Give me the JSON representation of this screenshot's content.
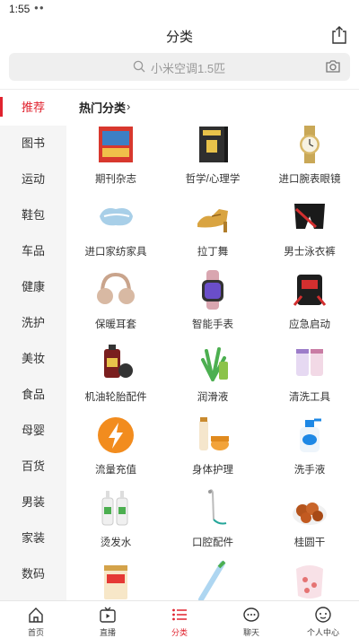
{
  "status": {
    "time": "1:55",
    "dots": "●●"
  },
  "header": {
    "title": "分类"
  },
  "search": {
    "placeholder": "小米空调1.5匹"
  },
  "sidebar": {
    "items": [
      {
        "label": "推荐",
        "active": true
      },
      {
        "label": "图书"
      },
      {
        "label": "运动"
      },
      {
        "label": "鞋包"
      },
      {
        "label": "车品"
      },
      {
        "label": "健康"
      },
      {
        "label": "洗护"
      },
      {
        "label": "美妆"
      },
      {
        "label": "食品"
      },
      {
        "label": "母婴"
      },
      {
        "label": "百货"
      },
      {
        "label": "男装"
      },
      {
        "label": "家装"
      },
      {
        "label": "数码"
      }
    ]
  },
  "section": {
    "title": "热门分类",
    "arrow": "›"
  },
  "categories": [
    {
      "label": "期刊杂志",
      "icon": "magazine-icon"
    },
    {
      "label": "哲学/心理学",
      "icon": "book-icon"
    },
    {
      "label": "进口腕表眼镜",
      "icon": "watch-icon"
    },
    {
      "label": "进口家纺家具",
      "icon": "pillow-icon"
    },
    {
      "label": "拉丁舞",
      "icon": "dance-shoe-icon"
    },
    {
      "label": "男士泳衣裤",
      "icon": "swim-trunks-icon"
    },
    {
      "label": "保暖耳套",
      "icon": "earmuff-icon"
    },
    {
      "label": "智能手表",
      "icon": "smartwatch-icon"
    },
    {
      "label": "应急启动",
      "icon": "jump-starter-icon"
    },
    {
      "label": "机油轮胎配件",
      "icon": "engine-oil-icon"
    },
    {
      "label": "润滑液",
      "icon": "aloe-gel-icon"
    },
    {
      "label": "清洗工具",
      "icon": "cleaning-cup-icon"
    },
    {
      "label": "流量充值",
      "icon": "lightning-icon"
    },
    {
      "label": "身体护理",
      "icon": "body-care-icon"
    },
    {
      "label": "洗手液",
      "icon": "hand-soap-icon"
    },
    {
      "label": "烫发水",
      "icon": "perm-bottle-icon"
    },
    {
      "label": "口腔配件",
      "icon": "oral-irrigator-icon"
    },
    {
      "label": "桂圆干",
      "icon": "longan-icon"
    },
    {
      "label": "",
      "icon": "milk-can-icon"
    },
    {
      "label": "",
      "icon": "toothbrush-icon"
    },
    {
      "label": "",
      "icon": "bib-icon"
    }
  ],
  "tabs": [
    {
      "label": "首页",
      "icon": "home-icon"
    },
    {
      "label": "直播",
      "icon": "live-tv-icon"
    },
    {
      "label": "分类",
      "icon": "list-icon",
      "active": true
    },
    {
      "label": "聊天",
      "icon": "chat-icon"
    },
    {
      "label": "个人中心",
      "icon": "profile-icon"
    }
  ],
  "colors": {
    "accent": "#e0232f",
    "sidebar_bg": "#f5f5f5",
    "search_bg": "#efefef"
  }
}
